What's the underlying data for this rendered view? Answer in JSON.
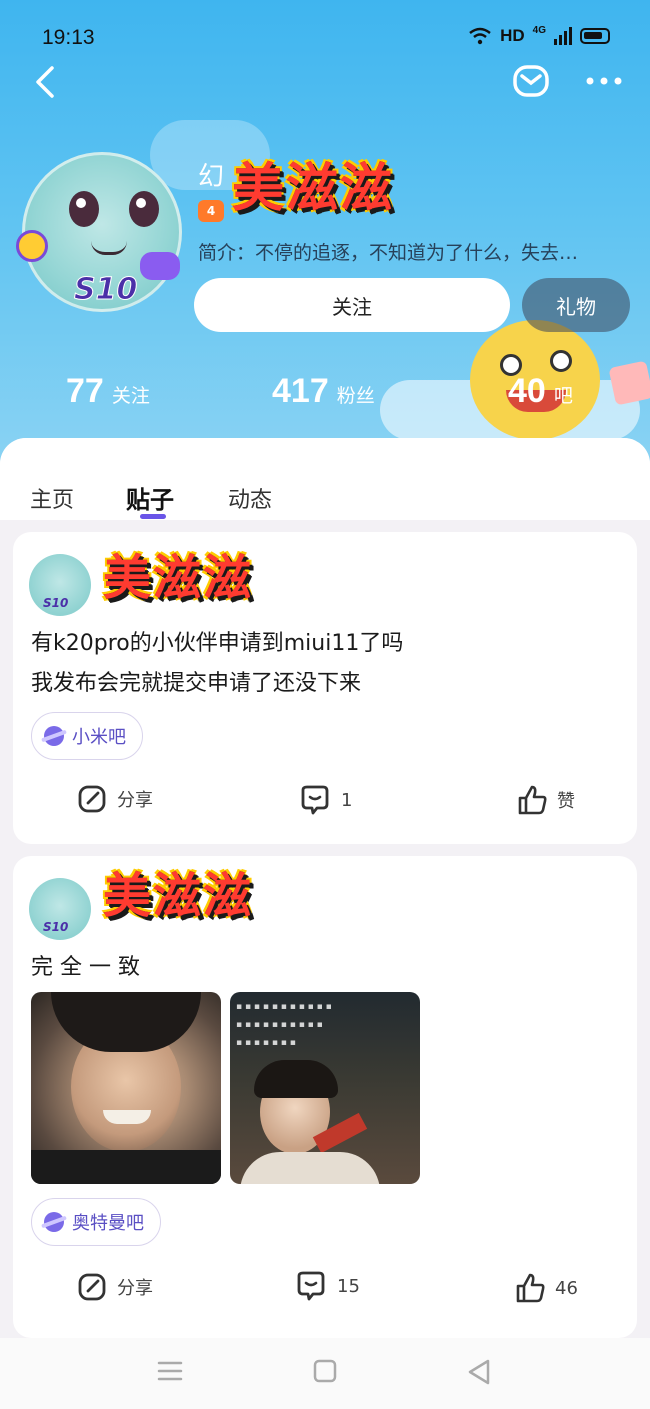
{
  "status_bar": {
    "time": "19:13",
    "hd": "HD",
    "network": "4G"
  },
  "profile": {
    "name_prefix": "幻",
    "name_art": "美滋滋",
    "level": "4",
    "avatar_badge": "S10",
    "bio": "简介：不停的追逐，不知道为了什么，失去…",
    "follow_label": "关注",
    "gift_label": "礼物",
    "stats": [
      {
        "value": "77",
        "label": "关注"
      },
      {
        "value": "417",
        "label": "粉丝"
      },
      {
        "value": "40",
        "label": "吧"
      }
    ]
  },
  "tabs": [
    {
      "label": "主页"
    },
    {
      "label": "贴子"
    },
    {
      "label": "动态"
    }
  ],
  "active_tab": "贴子",
  "posts": [
    {
      "author_art": "美滋滋",
      "avatar_badge": "S10",
      "lines": [
        "有k20pro的小伙伴申请到miui11了吗",
        "我发布会完就提交申请了还没下来"
      ],
      "tag": "小米吧",
      "share_label": "分享",
      "comments": "1",
      "like_label": "赞"
    },
    {
      "author_art": "美滋滋",
      "avatar_badge": "S10",
      "lines": [
        "完 全 一 致"
      ],
      "tag": "奥特曼吧",
      "share_label": "分享",
      "comments": "15",
      "likes": "46"
    }
  ],
  "colors": {
    "accent": "#6a55e8",
    "header_sky": "#3fb5ef",
    "name_red": "#ff3b30",
    "name_outline": "#ffcc00"
  }
}
